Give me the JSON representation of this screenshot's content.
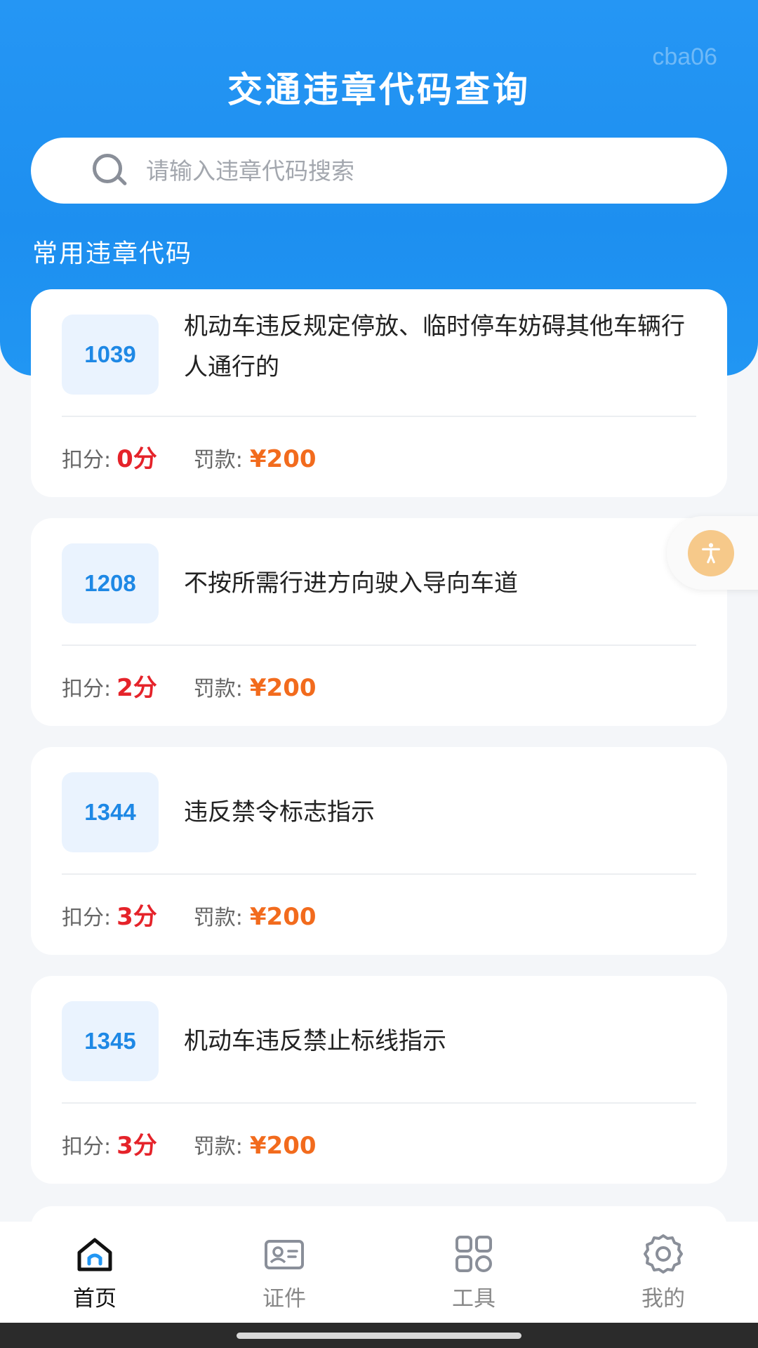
{
  "header": {
    "title": "交通违章代码查询",
    "watermark": "cba06"
  },
  "search": {
    "placeholder": "请输入违章代码搜索",
    "icon": "search-icon"
  },
  "section_title": "常用违章代码",
  "labels": {
    "points": "扣分:",
    "fine": "罚款:"
  },
  "violations": [
    {
      "code": "1039",
      "description": "机动车违反规定停放、临时停车妨碍其他车辆行人通行的",
      "points": "0分",
      "fine": "¥200"
    },
    {
      "code": "1208",
      "description": "不按所需行进方向驶入导向车道",
      "points": "2分",
      "fine": "¥200"
    },
    {
      "code": "1344",
      "description": "违反禁令标志指示",
      "points": "3分",
      "fine": "¥200"
    },
    {
      "code": "1345",
      "description": "机动车违反禁止标线指示",
      "points": "3分",
      "fine": "¥200"
    }
  ],
  "bottom_nav": [
    {
      "label": "首页",
      "icon": "home-icon",
      "active": true
    },
    {
      "label": "证件",
      "icon": "id-card-icon",
      "active": false
    },
    {
      "label": "工具",
      "icon": "grid-tools-icon",
      "active": false
    },
    {
      "label": "我的",
      "icon": "gear-icon",
      "active": false
    }
  ],
  "colors": {
    "header_blue": "#2196f3",
    "code_blue": "#1e88e5",
    "points_red": "#e5232a",
    "fine_orange": "#f26b1d",
    "accessibility_orange": "#f6c98a"
  }
}
